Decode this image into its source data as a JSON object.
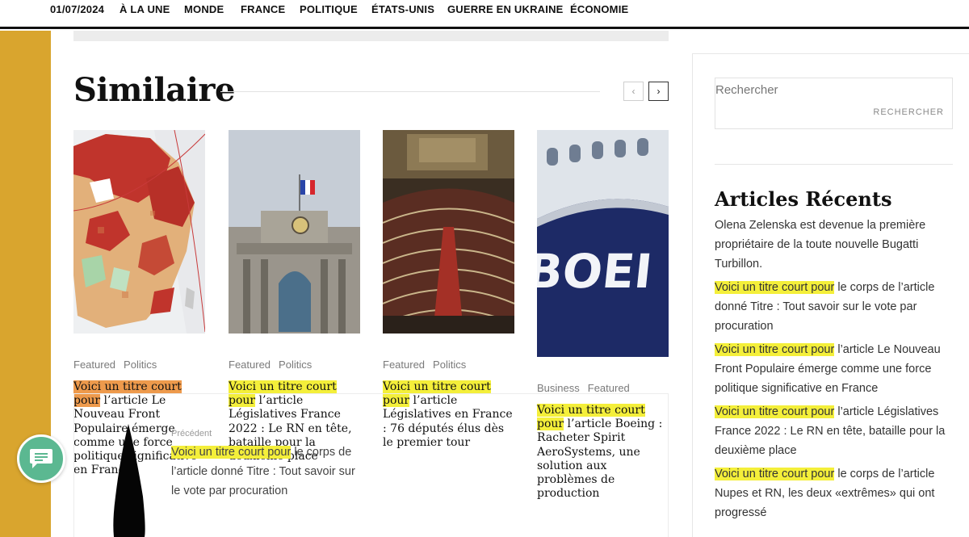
{
  "nav": {
    "date": "01/07/2024",
    "items": [
      "À LA UNE",
      "MONDE",
      "FRANCE",
      "POLITIQUE",
      "ÉTATS-UNIS",
      "GUERRE EN UKRAINE",
      "ÉCONOMIE"
    ]
  },
  "similaire": {
    "title": "Similaire",
    "prev_icon": "chevron-left-icon",
    "next_icon": "chevron-right-icon",
    "prev_glyph": "‹",
    "next_glyph": "›"
  },
  "cards": [
    {
      "image": "map-of-france-election-results",
      "categories": [
        "Featured",
        "Politics"
      ],
      "highlight": "Voici un titre court pour",
      "rest": " l’article Le Nouveau Front Populaire émerge comme une force politique significative en France"
    },
    {
      "image": "assemblee-nationale-facade",
      "categories": [
        "Featured",
        "Politics"
      ],
      "highlight": "Voici un titre court pour",
      "rest": " l’article Législatives France 2022 : Le RN en tête, bataille pour la deuxième place"
    },
    {
      "image": "assemblee-nationale-hemicycle",
      "categories": [
        "Featured",
        "Politics"
      ],
      "highlight": "Voici un titre court pour",
      "rest": " l’article Législatives en France : 76 députés élus dès le premier tour"
    },
    {
      "image": "boeing-aircraft-fuselage",
      "categories": [
        "Business",
        "Featured"
      ],
      "highlight": "Voici un titre court pour",
      "rest": " l’article Boeing : Racheter Spirit AeroSystems, une solution aux problèmes de production"
    }
  ],
  "previous": {
    "label": "Précédent",
    "highlight": "Voici un titre court pour",
    "rest": " le corps de l’article donné Titre : Tout savoir sur le vote par procuration"
  },
  "sidebar": {
    "search_placeholder": "Rechercher",
    "search_button": "RECHERCHER",
    "recent_title": "Articles Récents",
    "recent": [
      {
        "highlight": "",
        "rest": "Olena Zelenska est devenue la première propriétaire de la toute nouvelle Bugatti Turbillon."
      },
      {
        "highlight": "Voici un titre court pour",
        "rest": " le corps de l’article donné Titre : Tout savoir sur le vote par procuration"
      },
      {
        "highlight": "Voici un titre court pour",
        "rest": " l’article Le Nouveau Front Populaire émerge comme une force politique significative en France"
      },
      {
        "highlight": "Voici un titre court pour",
        "rest": " l’article Législatives France 2022 : Le RN en tête, bataille pour la deuxième place"
      },
      {
        "highlight": "Voici un titre court pour",
        "rest": " le corps de l’article Nupes et RN, les deux «extrêmes» qui ont progressé"
      }
    ]
  },
  "chat": {
    "icon": "chat-bubble-icon"
  },
  "colors": {
    "gold": "#d9a52e",
    "highlight_yellow": "#f4ef3a",
    "highlight_orange": "#ee9a4c",
    "chat_green": "#5bb891"
  }
}
